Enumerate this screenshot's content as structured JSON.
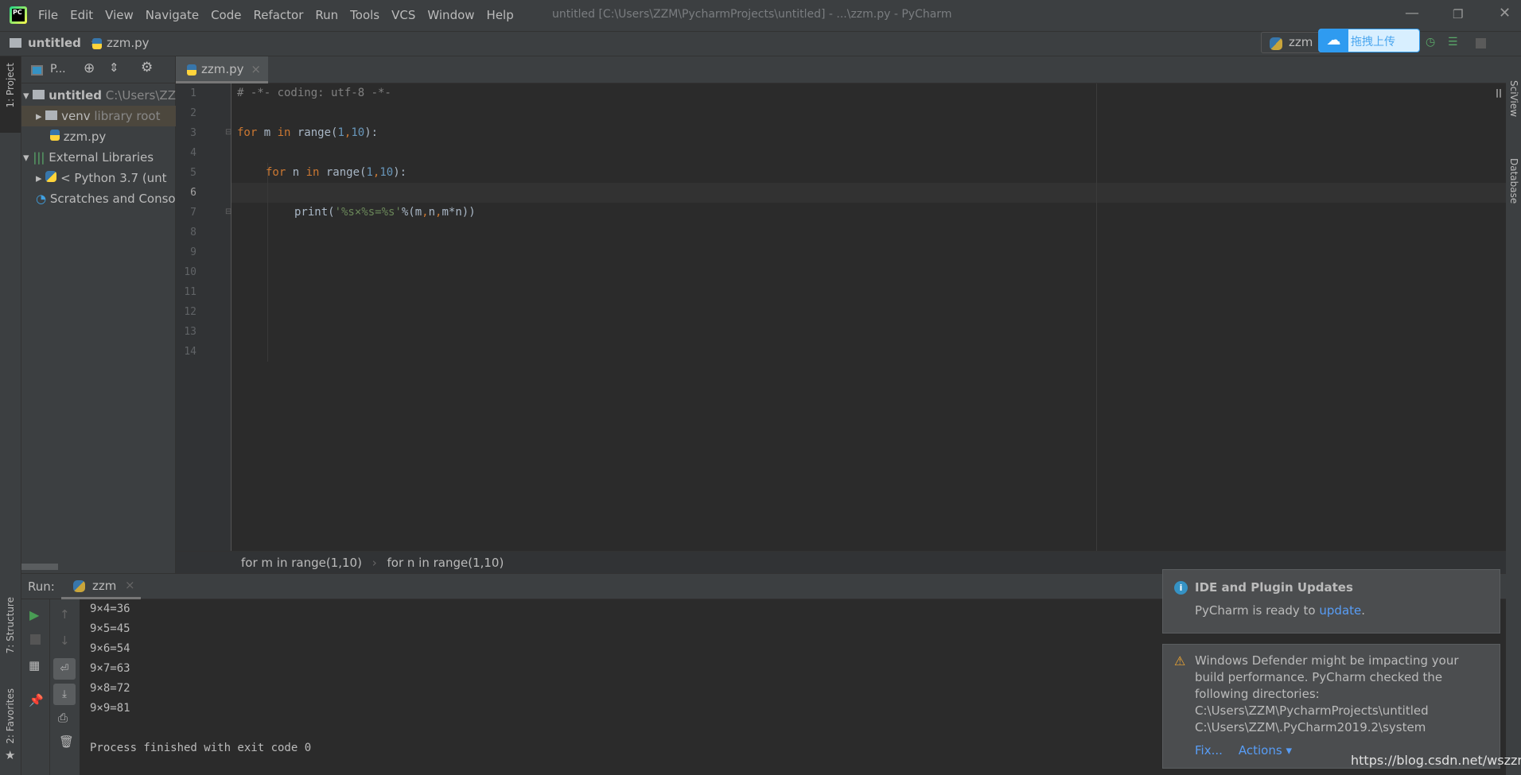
{
  "window": {
    "title": "untitled [C:\\Users\\ZZM\\PycharmProjects\\untitled] - ...\\zzm.py - PyCharm",
    "logo": "PC"
  },
  "menu": [
    "File",
    "Edit",
    "View",
    "Navigate",
    "Code",
    "Refactor",
    "Run",
    "Tools",
    "VCS",
    "Window",
    "Help"
  ],
  "nav": {
    "project": "untitled",
    "file": "zzm.py",
    "run_config": "zzm",
    "upload_label": "拖拽上传"
  },
  "left_strip": {
    "project": "1: Project",
    "structure": "7: Structure",
    "favorites": "2: Favorites"
  },
  "right_strip": {
    "sciview": "SciView",
    "database": "Database"
  },
  "project_panel": {
    "dropdown": "P...",
    "tree": [
      {
        "label": "untitled",
        "hint": "C:\\Users\\ZZ"
      },
      {
        "label": "venv",
        "hint": "library root"
      },
      {
        "label": "zzm.py",
        "hint": ""
      },
      {
        "label": "External Libraries",
        "hint": ""
      },
      {
        "label": "< Python 3.7 (unt",
        "hint": ""
      },
      {
        "label": "Scratches and Conso",
        "hint": ""
      }
    ]
  },
  "editor": {
    "tab": "zzm.py",
    "line_numbers": [
      "1",
      "2",
      "3",
      "4",
      "5",
      "6",
      "7",
      "8",
      "9",
      "10",
      "11",
      "12",
      "13",
      "14"
    ],
    "code": {
      "l1": "# -*- coding: utf-8 -*-",
      "l3": [
        "for",
        " m ",
        "in",
        " range(",
        "1",
        ",",
        "10",
        "):"
      ],
      "l5": [
        "for",
        " n ",
        "in",
        " range(",
        "1",
        ",",
        "10",
        "):"
      ],
      "l7": [
        "print(",
        "'%s×%s=%s'",
        "%(m",
        ",",
        "n",
        ",",
        "m*n))"
      ]
    },
    "breadcrumbs": [
      "for m in range(1,10)",
      "for n in range(1,10)"
    ]
  },
  "run": {
    "label": "Run:",
    "tab": "zzm",
    "output": [
      "9×4=36",
      "9×5=45",
      "9×6=54",
      "9×7=63",
      "9×8=72",
      "9×9=81",
      "",
      "Process finished with exit code 0"
    ]
  },
  "notifications": [
    {
      "title": "IDE and Plugin Updates",
      "text": "PyCharm is ready to ",
      "link": "update",
      "end": "."
    },
    {
      "lines": [
        "Windows Defender might be impacting your",
        "build performance. PyCharm checked the",
        "following directories:",
        "C:\\Users\\ZZM\\PycharmProjects\\untitled",
        "C:\\Users\\ZZM\\.PyCharm2019.2\\system"
      ],
      "fix": "Fix...",
      "actions": "Actions ▾"
    }
  ],
  "watermark": "https://blog.csdn.net/wszzmo",
  "colors": {
    "keyword": "#cc7832",
    "number": "#6897bb",
    "string": "#6a8759",
    "link": "#589df6"
  }
}
